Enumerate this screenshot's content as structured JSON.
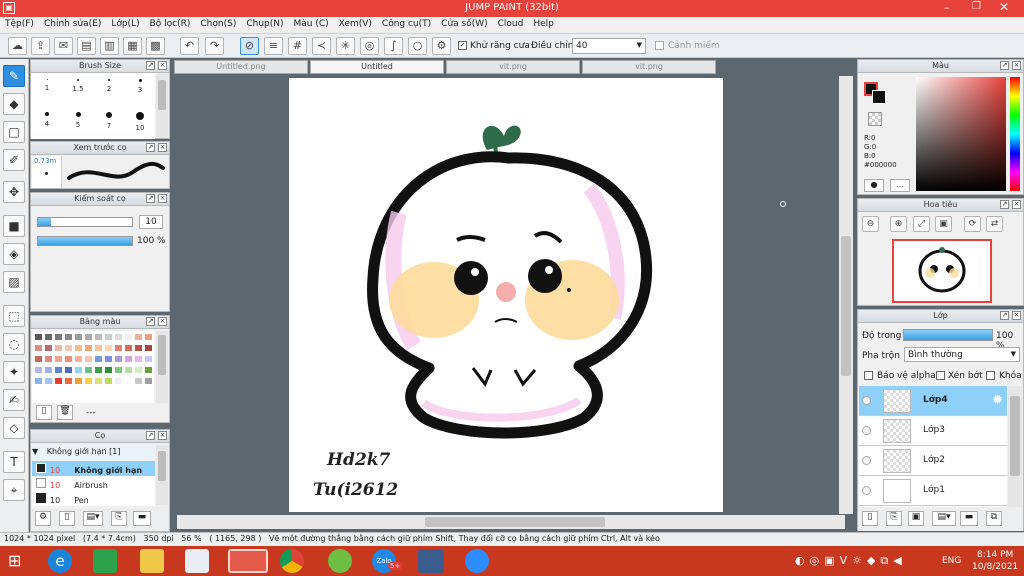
{
  "app": {
    "title": "JUMP PAINT (32bit)"
  },
  "menu": [
    "Tệp(F)",
    "Chỉnh sửa(E)",
    "Lớp(L)",
    "Bộ lọc(R)",
    "Chọn(S)",
    "Chụp(N)",
    "Màu (C)",
    "Xem(V)",
    "Công cụ(T)",
    "Cửa số(W)",
    "Cloud",
    "Help"
  ],
  "toolbar": {
    "antialias_label": "Khử răng cưa",
    "adjust_label": "Điều chỉnh",
    "adjust_value": "40",
    "warn_label": "Cảnh miểm"
  },
  "tabs": [
    "Untitled.png",
    "Untitled",
    "vit.png",
    "vit.png"
  ],
  "brush_size": {
    "title": "Brush Size",
    "cells": [
      "1",
      "1.5",
      "2",
      "3",
      "4",
      "5",
      "7",
      "10"
    ]
  },
  "preview": {
    "title": "Xem trước cọ",
    "value": "0.73m"
  },
  "control": {
    "title": "Kiểm soát cọ",
    "size_value": "10",
    "opacity_value": "100 %"
  },
  "palette": {
    "title": "Bảng màu",
    "footer": "---",
    "colors": [
      "#585858",
      "#686868",
      "#787878",
      "#888888",
      "#9a9a9a",
      "#aaaaaa",
      "#bbbbbb",
      "#cccccc",
      "#dddddd",
      "#eeeeee",
      "#e8b39a",
      "#ee9e80",
      "#d98e86",
      "#b56c6c",
      "#eeb9a6",
      "#f2c8b4",
      "#f6b98c",
      "#f3a873",
      "#f7c39b",
      "#fbd6b7",
      "#e57e6b",
      "#d6685c",
      "#b85046",
      "#a34444",
      "#c16a5c",
      "#dd8c80",
      "#f0a58f",
      "#e7917b",
      "#f5b39b",
      "#f7c6b2",
      "#6fa1d9",
      "#7f8ee0",
      "#a89be0",
      "#d8a0e0",
      "#e7b8ea",
      "#c7c7f2",
      "#b6b6e8",
      "#9fb0e8",
      "#5b87d0",
      "#4e6fb8",
      "#8fd4f2",
      "#6ac08a",
      "#3aa049",
      "#2f8d3f",
      "#82c87e",
      "#b3e0a8",
      "#d2eec2",
      "#6a9f3c",
      "#89b4ea",
      "#a2c4f0",
      "#e83a32",
      "#e86b3c",
      "#f2a33c",
      "#f4d24a",
      "#dbe07a",
      "#bfd95e",
      "#f0f0f0",
      "#ffffff",
      "#c8c8c8",
      "#a0a0a0"
    ]
  },
  "brush_list": {
    "title": "Cọ",
    "group": "Không giới hạn [1]",
    "items": [
      {
        "size": "10",
        "name": "Không giới hạn"
      },
      {
        "size": "10",
        "name": "Airbrush"
      },
      {
        "size": "10",
        "name": "Pen"
      }
    ]
  },
  "color_panel": {
    "title": "Màu",
    "r": "R:0",
    "g": "G:0",
    "b": "B:0",
    "hex": "#000000",
    "accent": "#e8423d"
  },
  "navigator": {
    "title": "Hoa tiêu"
  },
  "layers": {
    "title": "Lớp",
    "opacity_label": "Độ trong",
    "opacity_value": "100 %",
    "blend_label": "Pha trộn",
    "blend_value": "Bình thường",
    "protect_alpha": "Bảo vệ alpha",
    "clip": "Xén bớt",
    "lock": "Khóa",
    "items": [
      "Lớp4",
      "Lớp3",
      "Lớp2",
      "Lớp1"
    ]
  },
  "canvas": {
    "signature_line1": "Hd2k7",
    "signature_line2": "Tu(i2612"
  },
  "status": {
    "text": "1024 * 1024 pixel   (7.4 * 7.4cm)   350 dpi   56 %   ( 1165, 298 )   Vẽ một đường thẳng bằng cách giữ phím Shift, Thay đổi cỡ cọ bằng cách giữ phím Ctrl, Alt và kéo"
  },
  "taskbar": {
    "lang": "ENG",
    "time": "8:14 PM",
    "date": "10/8/2021",
    "zalo_badge": "5+"
  },
  "icons": [
    "menu-icon",
    "minimize-icon",
    "maximize-icon",
    "close-icon",
    "brush-icon",
    "eraser-icon",
    "select-rect-icon",
    "move-icon",
    "fill-icon",
    "text-icon",
    "windows-start-icon",
    "ie-icon",
    "store-icon",
    "explorer-icon",
    "zalo-icon"
  ]
}
